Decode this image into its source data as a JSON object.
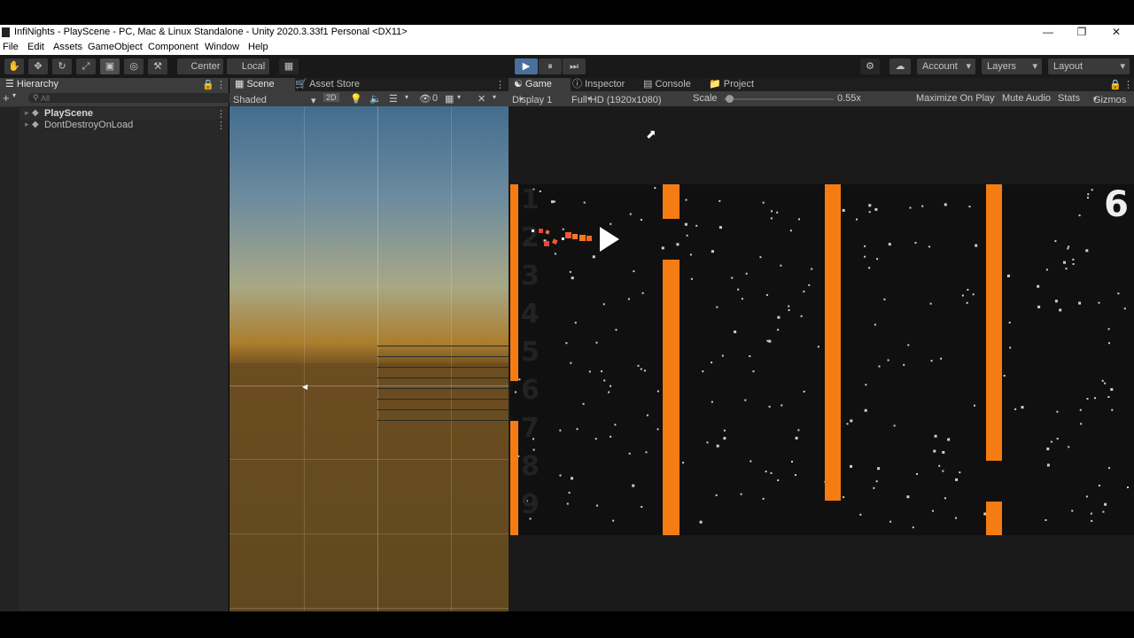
{
  "window": {
    "title": "InfiNights - PlayScene - PC, Mac & Linux Standalone - Unity 2020.3.33f1 Personal <DX11>",
    "minimize": "—",
    "maximize": "❐",
    "close": "✕"
  },
  "menu": [
    "File",
    "Edit",
    "Assets",
    "GameObject",
    "Component",
    "Window",
    "Help"
  ],
  "toolbar": {
    "tools": [
      "hand-icon",
      "move-icon",
      "rotate-icon",
      "scale-icon",
      "rect-icon",
      "transform-icon",
      "custom-tool-icon"
    ],
    "tool_glyphs": [
      "✋",
      "✥",
      "↻",
      "⤢",
      "▣",
      "◎",
      "⚒"
    ],
    "center": "Center",
    "local": "Local",
    "play": "▶",
    "pause": "⏸",
    "step": "⏭",
    "account": "Account",
    "layers": "Layers",
    "layout": "Layout"
  },
  "hierarchy": {
    "tab": "Hierarchy",
    "add": "+",
    "search_placeholder": "All",
    "items": [
      "PlayScene",
      "DontDestroyOnLoad"
    ]
  },
  "scene": {
    "tabs": [
      "Scene",
      "Asset Store"
    ],
    "shading": "Shaded",
    "mode_2d": "2D",
    "hidden_count": "0"
  },
  "game": {
    "tabs": [
      "Game",
      "Inspector",
      "Console",
      "Project"
    ],
    "display": "Display 1",
    "resolution": "Full HD (1920x1080)",
    "scale_label": "Scale",
    "scale_value": "0.55x",
    "scale_level": 0.05,
    "maximize_on_play": "Maximize On Play",
    "mute_audio": "Mute Audio",
    "stats": "Stats",
    "gizmos": "Gizmos",
    "score": "6",
    "row_numbers": [
      "1",
      "2",
      "3",
      "4",
      "5",
      "6",
      "7",
      "8",
      "9"
    ]
  },
  "colors": {
    "pipe": "#f47c12",
    "play_active": "#4a6f9c"
  }
}
